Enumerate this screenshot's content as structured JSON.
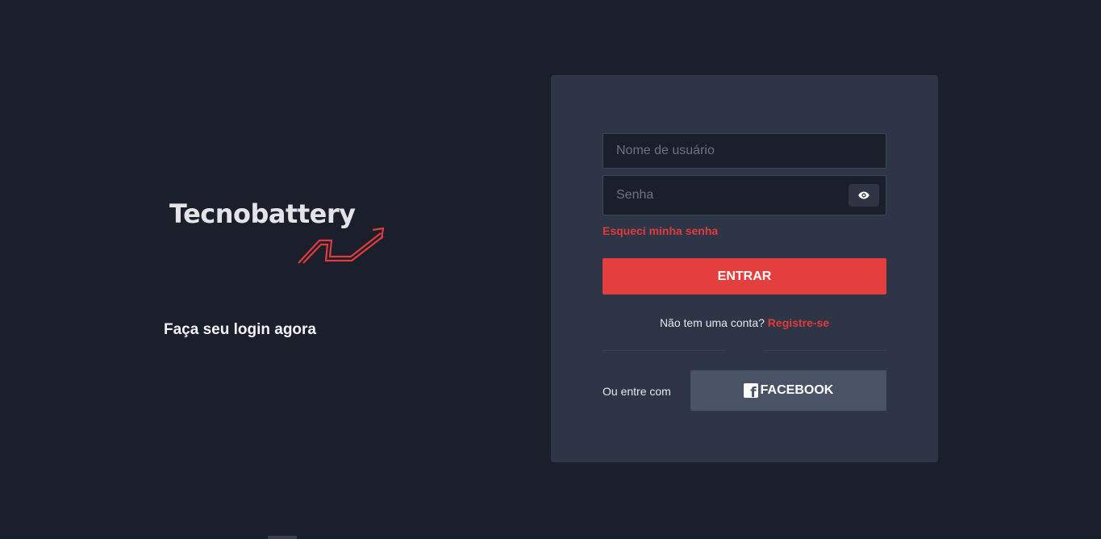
{
  "brand": {
    "name": "Tecnobattery",
    "tagline": "Faça seu login agora",
    "accent_color": "#e53e3e"
  },
  "login_form": {
    "username_placeholder": "Nome de usuário",
    "password_placeholder": "Senha",
    "password_toggle_icon": "eye-icon",
    "forgot_password": "Esqueci minha senha",
    "submit_label": "ENTRAR",
    "no_account_text": "Não tem uma conta?",
    "register_label": "Registre-se"
  },
  "social": {
    "label": "Ou entre com",
    "facebook_label": "FACEBOOK",
    "facebook_icon": "facebook-icon"
  }
}
